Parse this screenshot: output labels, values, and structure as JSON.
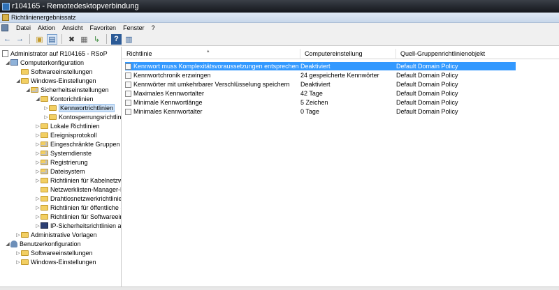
{
  "rdp_window": {
    "title": "r104165 - Remotedesktopverbindung"
  },
  "mmc": {
    "title": "Richtlinienergebnissatz"
  },
  "menu": [
    "Datei",
    "Aktion",
    "Ansicht",
    "Favoriten",
    "Fenster",
    "?"
  ],
  "toolbar": {
    "icons": [
      "back-arrow-icon",
      "forward-arrow-icon",
      "up-folder-icon",
      "show-tree-icon",
      "delete-icon",
      "properties-icon",
      "export-icon",
      "help-icon",
      "view-icon"
    ]
  },
  "tree": [
    {
      "label": "Administrator auf R104165 - RSoP",
      "icon": "document-icon",
      "arrow": ""
    },
    {
      "label": "Computerkonfiguration",
      "icon": "computer-icon",
      "arrow": "◢"
    },
    {
      "label": "Softwareeinstellungen",
      "icon": "folder-icon",
      "arrow": ""
    },
    {
      "label": "Windows-Einstellungen",
      "icon": "folder-icon",
      "arrow": "◢"
    },
    {
      "label": "Sicherheitseinstellungen",
      "icon": "security-folder-icon",
      "arrow": "◢"
    },
    {
      "label": "Kontorichtlinien",
      "icon": "folder-icon",
      "arrow": "◢"
    },
    {
      "label": "Kennwortrichtlinien",
      "icon": "folder-icon",
      "arrow": "▷",
      "selected": true
    },
    {
      "label": "Kontosperrungsrichtlinie",
      "icon": "folder-icon",
      "arrow": "▷"
    },
    {
      "label": "Lokale Richtlinien",
      "icon": "folder-icon",
      "arrow": "▷"
    },
    {
      "label": "Ereignisprotokoll",
      "icon": "folder-icon",
      "arrow": "▷"
    },
    {
      "label": "Eingeschränkte Gruppen",
      "icon": "folder-icon",
      "arrow": "▷"
    },
    {
      "label": "Systemdienste",
      "icon": "folder-icon",
      "arrow": "▷"
    },
    {
      "label": "Registrierung",
      "icon": "folder-icon",
      "arrow": "▷"
    },
    {
      "label": "Dateisystem",
      "icon": "folder-icon",
      "arrow": "▷"
    },
    {
      "label": "Richtlinien für Kabelnetzwe",
      "icon": "folder-icon",
      "arrow": "▷"
    },
    {
      "label": "Netzwerklisten-Manager-R",
      "icon": "folder-icon",
      "arrow": ""
    },
    {
      "label": "Drahtlosnetzwerkrichtlinien",
      "icon": "folder-icon",
      "arrow": "▷"
    },
    {
      "label": "Richtlinien für öffentliche S",
      "icon": "folder-icon",
      "arrow": "▷"
    },
    {
      "label": "Richtlinien für Softwareein",
      "icon": "folder-icon",
      "arrow": "▷"
    },
    {
      "label": "IP-Sicherheitsrichtlinien au",
      "icon": "ipsec-icon",
      "arrow": "▷"
    },
    {
      "label": "Administrative Vorlagen",
      "icon": "folder-icon",
      "arrow": "▷"
    },
    {
      "label": "Benutzerkonfiguration",
      "icon": "user-icon",
      "arrow": "◢"
    },
    {
      "label": "Softwareeinstellungen",
      "icon": "folder-icon",
      "arrow": "▷"
    },
    {
      "label": "Windows-Einstellungen",
      "icon": "folder-icon",
      "arrow": "▷"
    }
  ],
  "table": {
    "columns": [
      "Richtlinie",
      "Computereinstellung",
      "Quell-Gruppenrichtlinienobjekt"
    ],
    "rows": [
      [
        "Kennwort muss Komplexitätsvoraussetzungen entsprechen",
        "Deaktiviert",
        "Default Domain Policy"
      ],
      [
        "Kennwortchronik erzwingen",
        "24 gespeicherte Kennwörter",
        "Default Domain Policy"
      ],
      [
        "Kennwörter mit umkehrbarer Verschlüsselung speichern",
        "Deaktiviert",
        "Default Domain Policy"
      ],
      [
        "Maximales Kennwortalter",
        "42 Tage",
        "Default Domain Policy"
      ],
      [
        "Minimale Kennwortlänge",
        "5 Zeichen",
        "Default Domain Policy"
      ],
      [
        "Minimales Kennwortalter",
        "0 Tage",
        "Default Domain Policy"
      ]
    ]
  }
}
